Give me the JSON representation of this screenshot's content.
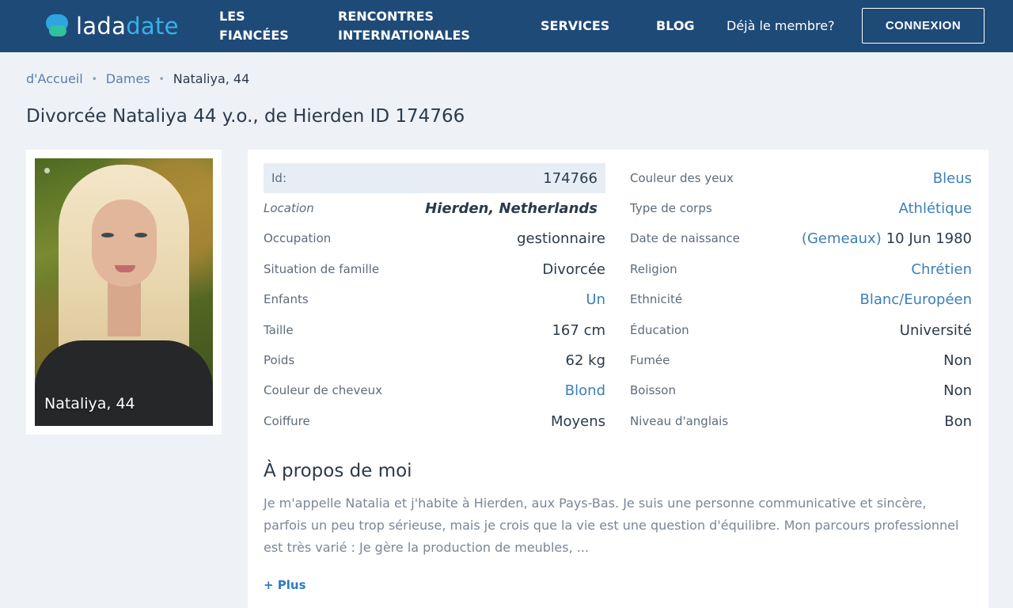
{
  "header": {
    "logo_prefix": "lada",
    "logo_suffix": "date",
    "nav": {
      "fiancees_line1": "LES",
      "fiancees_line2": "FIANCÉES",
      "international_line1": "RENCONTRES",
      "international_line2": "INTERNATIONALES",
      "services": "SERVICES",
      "blog": "BLOG",
      "member": "Déjà le membre?"
    },
    "login_button": "CONNEXION"
  },
  "breadcrumb": {
    "home": "d'Accueil",
    "section": "Dames",
    "current": "Nataliya, 44",
    "separator": "•"
  },
  "page_title": "Divorcée Nataliya 44 y.o., de Hierden ID 174766",
  "photo": {
    "caption": "Nataliya, 44"
  },
  "profile": {
    "left": [
      {
        "label": "Id:",
        "value": "174766"
      },
      {
        "label": "Location",
        "value": "Hierden, Netherlands"
      },
      {
        "label": "Occupation",
        "value": "gestionnaire"
      },
      {
        "label": "Situation de famille",
        "value": "Divorcée"
      },
      {
        "label": "Enfants",
        "value": "Un"
      },
      {
        "label": "Taille",
        "value": "167 cm"
      },
      {
        "label": "Poids",
        "value": "62 kg"
      },
      {
        "label": "Couleur de cheveux",
        "value": "Blond"
      },
      {
        "label": "Coiffure",
        "value": "Moyens"
      }
    ],
    "right": [
      {
        "label": "Couleur des yeux",
        "value": "Bleus"
      },
      {
        "label": "Type de corps",
        "value": "Athlétique"
      },
      {
        "label": "Date de naissance",
        "zodiac": "Gemeaux",
        "open": "(",
        "close": ")",
        "value": "10 Jun 1980"
      },
      {
        "label": "Religion",
        "value": "Chrétien"
      },
      {
        "label": "Ethnicité",
        "value": "Blanc/Européen"
      },
      {
        "label": "Éducation",
        "value": "Université"
      },
      {
        "label": "Fumée",
        "value": "Non"
      },
      {
        "label": "Boisson",
        "value": "Non"
      },
      {
        "label": "Niveau d'anglais",
        "value": "Bon"
      }
    ]
  },
  "about": {
    "title": "À propos de moi",
    "text": "Je m'appelle Natalia et j'habite à Hierden, aux Pays-Bas. Je suis une personne communicative et sincère, parfois un peu trop sérieuse, mais je crois que la vie est une question d'équilibre. Mon parcours professionnel est très varié : Je gère la production de meubles, ...",
    "more_label": "+ Plus"
  },
  "colors": {
    "header_bg": "#1e4a78",
    "link": "#3c7fb8",
    "page_bg": "#eef2f7"
  }
}
